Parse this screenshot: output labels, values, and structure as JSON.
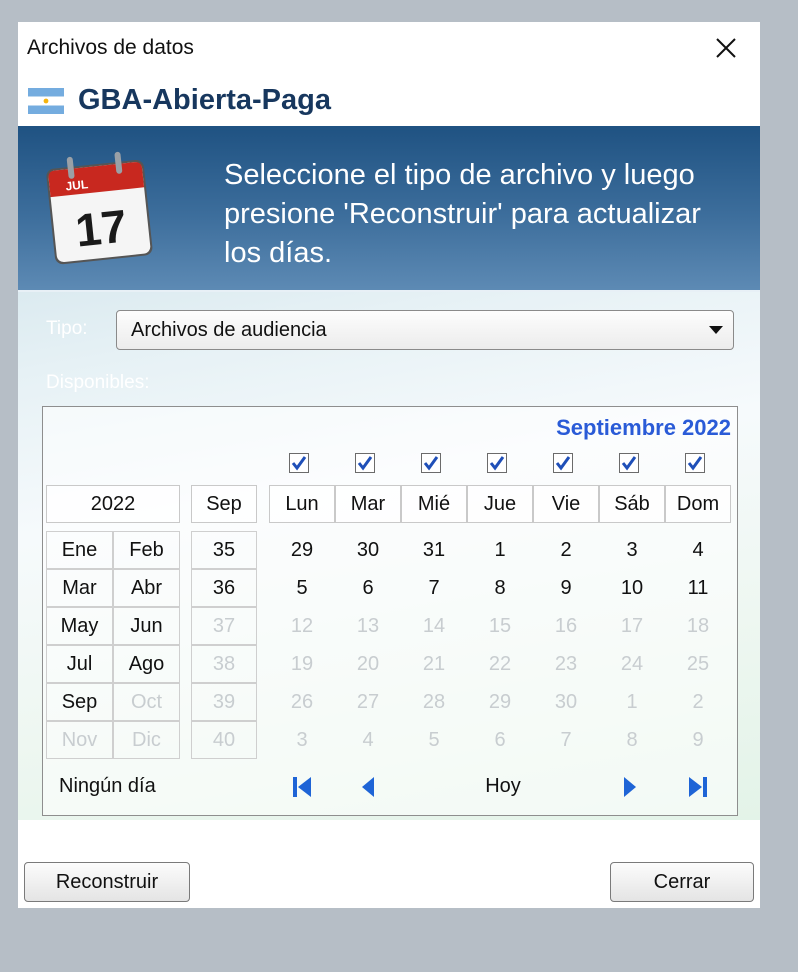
{
  "window": {
    "title": "Archivos de datos",
    "app_name": "GBA-Abierta-Paga"
  },
  "banner": {
    "message": "Seleccione el tipo de archivo y luego presione 'Reconstruir' para actualizar los días.",
    "icon_month": "JUL",
    "icon_day": "17"
  },
  "tipo": {
    "label": "Tipo:",
    "selected": "Archivos de audiencia"
  },
  "disponibles_label": "Disponibles:",
  "calendar": {
    "month_title": "Septiembre 2022",
    "year": "2022",
    "month_short": "Sep",
    "weekdays": [
      "Lun",
      "Mar",
      "Mié",
      "Jue",
      "Vie",
      "Sáb",
      "Dom"
    ],
    "weekday_checked": [
      true,
      true,
      true,
      true,
      true,
      true,
      true
    ],
    "months": [
      {
        "name": "Ene",
        "enabled": true
      },
      {
        "name": "Feb",
        "enabled": true
      },
      {
        "name": "Mar",
        "enabled": true
      },
      {
        "name": "Abr",
        "enabled": true
      },
      {
        "name": "May",
        "enabled": true
      },
      {
        "name": "Jun",
        "enabled": true
      },
      {
        "name": "Jul",
        "enabled": true
      },
      {
        "name": "Ago",
        "enabled": true
      },
      {
        "name": "Sep",
        "enabled": true
      },
      {
        "name": "Oct",
        "enabled": false
      },
      {
        "name": "Nov",
        "enabled": false
      },
      {
        "name": "Dic",
        "enabled": false
      }
    ],
    "weeks": [
      {
        "num": "35",
        "enabled": true,
        "days": [
          {
            "d": "29",
            "on": true
          },
          {
            "d": "30",
            "on": true
          },
          {
            "d": "31",
            "on": true
          },
          {
            "d": "1",
            "on": true
          },
          {
            "d": "2",
            "on": true
          },
          {
            "d": "3",
            "on": true
          },
          {
            "d": "4",
            "on": true
          }
        ]
      },
      {
        "num": "36",
        "enabled": true,
        "days": [
          {
            "d": "5",
            "on": true
          },
          {
            "d": "6",
            "on": true
          },
          {
            "d": "7",
            "on": true
          },
          {
            "d": "8",
            "on": true
          },
          {
            "d": "9",
            "on": true
          },
          {
            "d": "10",
            "on": true
          },
          {
            "d": "11",
            "on": true
          }
        ]
      },
      {
        "num": "37",
        "enabled": false,
        "days": [
          {
            "d": "12",
            "on": false
          },
          {
            "d": "13",
            "on": false
          },
          {
            "d": "14",
            "on": false
          },
          {
            "d": "15",
            "on": false
          },
          {
            "d": "16",
            "on": false
          },
          {
            "d": "17",
            "on": false
          },
          {
            "d": "18",
            "on": false
          }
        ]
      },
      {
        "num": "38",
        "enabled": false,
        "days": [
          {
            "d": "19",
            "on": false
          },
          {
            "d": "20",
            "on": false
          },
          {
            "d": "21",
            "on": false
          },
          {
            "d": "22",
            "on": false
          },
          {
            "d": "23",
            "on": false
          },
          {
            "d": "24",
            "on": false
          },
          {
            "d": "25",
            "on": false
          }
        ]
      },
      {
        "num": "39",
        "enabled": false,
        "days": [
          {
            "d": "26",
            "on": false
          },
          {
            "d": "27",
            "on": false
          },
          {
            "d": "28",
            "on": false
          },
          {
            "d": "29",
            "on": false
          },
          {
            "d": "30",
            "on": false
          },
          {
            "d": "1",
            "on": false
          },
          {
            "d": "2",
            "on": false
          }
        ]
      },
      {
        "num": "40",
        "enabled": false,
        "days": [
          {
            "d": "3",
            "on": false
          },
          {
            "d": "4",
            "on": false
          },
          {
            "d": "5",
            "on": false
          },
          {
            "d": "6",
            "on": false
          },
          {
            "d": "7",
            "on": false
          },
          {
            "d": "8",
            "on": false
          },
          {
            "d": "9",
            "on": false
          }
        ]
      }
    ],
    "no_day": "Ningún día",
    "today": "Hoy"
  },
  "buttons": {
    "rebuild": "Reconstruir",
    "close": "Cerrar"
  },
  "colors": {
    "accent": "#2a5bd7",
    "banner": "#2b5d8c",
    "app_name": "#17375e",
    "disabled_text": "#c8cdd0",
    "nav_arrow": "#1e64d6"
  }
}
